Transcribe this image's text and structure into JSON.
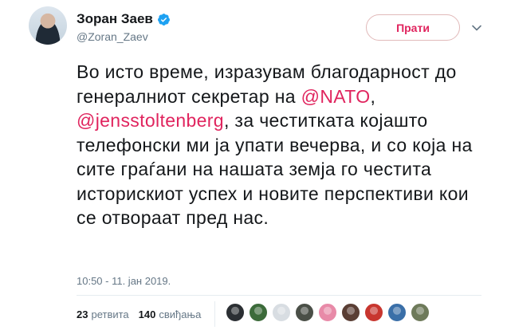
{
  "author": {
    "display_name": "Зоран Заев",
    "handle": "@Zoran_Zaev",
    "verified_icon": "verified-badge-icon",
    "avatar_icon": "profile-avatar"
  },
  "actions": {
    "follow_label": "Прати",
    "more_icon": "chevron-down-icon"
  },
  "tweet": {
    "text_part1": "Во исто време, изразувам благодарност до генералниот секретар на ",
    "mention1": "@NATO",
    "text_part2": ", ",
    "mention2": "@jensstoltenberg",
    "text_part3": ", за честитката којашто телефонски ми ја упати вечерва, и со која на сите граѓани на нашата земја го честита историскиот успех и новите перспективи кои се отвораат пред нас.",
    "timestamp": "10:50 - 11. јан 2019."
  },
  "stats": {
    "retweets_count": "23",
    "retweets_label": "ретвита",
    "likes_count": "140",
    "likes_label": "свиђања"
  },
  "likers": [
    {
      "name": "liker-avatar-1",
      "color": "#2b2f33"
    },
    {
      "name": "liker-avatar-2",
      "color": "#3c6b3a"
    },
    {
      "name": "liker-avatar-3",
      "color": "#d8dde2"
    },
    {
      "name": "liker-avatar-4",
      "color": "#4a4f47"
    },
    {
      "name": "liker-avatar-5",
      "color": "#e88aa8"
    },
    {
      "name": "liker-avatar-6",
      "color": "#5a3e34"
    },
    {
      "name": "liker-avatar-7",
      "color": "#c8362f"
    },
    {
      "name": "liker-avatar-8",
      "color": "#3a6fa8"
    },
    {
      "name": "liker-avatar-9",
      "color": "#6e7a5a"
    }
  ],
  "colors": {
    "accent": "#e0245e",
    "secondary_text": "#657786",
    "verified": "#1da1f2"
  }
}
